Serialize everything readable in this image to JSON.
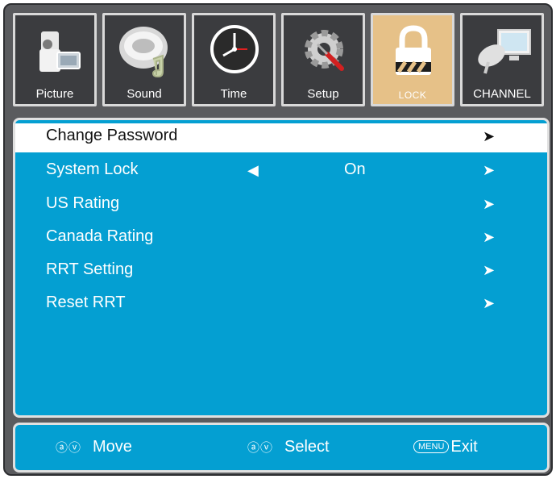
{
  "tabs": [
    {
      "label": "Picture",
      "icon": "camcorder-icon"
    },
    {
      "label": "Sound",
      "icon": "speaker-icon"
    },
    {
      "label": "Time",
      "icon": "clock-icon"
    },
    {
      "label": "Setup",
      "icon": "gear-tools-icon"
    },
    {
      "label": "LOCK",
      "icon": "padlock-icon",
      "active": true
    },
    {
      "label": "CHANNEL",
      "icon": "satellite-dish-icon"
    }
  ],
  "menu": {
    "items": [
      {
        "label": "Change Password",
        "arrow": "➤",
        "selected": true
      },
      {
        "label": "System Lock",
        "left_arrow": "◀",
        "value": "On",
        "arrow": "➤"
      },
      {
        "label": "US Rating",
        "arrow": "➤"
      },
      {
        "label": "Canada Rating",
        "arrow": "➤"
      },
      {
        "label": "RRT Setting",
        "arrow": "➤"
      },
      {
        "label": "Reset RRT",
        "arrow": "➤"
      }
    ]
  },
  "footer": {
    "move": {
      "glyphs": "ⓐⓥ",
      "label": "Move"
    },
    "select": {
      "glyphs": "ⓐⓥ",
      "label": "Select"
    },
    "exit": {
      "key": "MENU",
      "label": "Exit"
    }
  },
  "colors": {
    "panel": "#049fd2",
    "frame": "#5a5b5e",
    "active_tab": "#e6c188"
  }
}
